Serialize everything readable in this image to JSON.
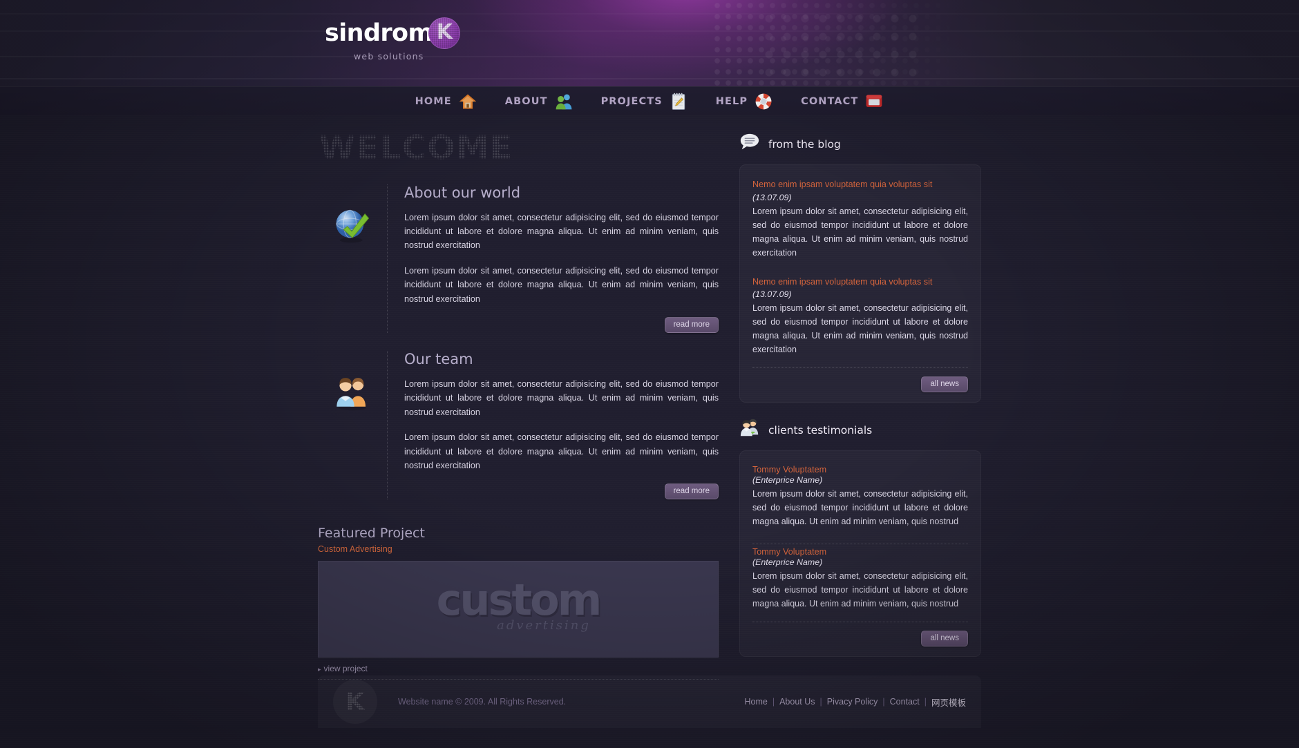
{
  "brand": {
    "word": "sindrom",
    "badge_letter": "K",
    "tagline": "web solutions"
  },
  "nav": {
    "items": [
      {
        "label": "HOME",
        "icon": "home-icon"
      },
      {
        "label": "ABOUT",
        "icon": "users-icon"
      },
      {
        "label": "PROJECTS",
        "icon": "notepad-icon"
      },
      {
        "label": "HELP",
        "icon": "lifering-icon"
      },
      {
        "label": "CONTACT",
        "icon": "phone-icon"
      }
    ]
  },
  "main": {
    "welcome": "WELCOME",
    "sections": [
      {
        "title": "About our world",
        "icon": "globe-check-icon",
        "paragraphs": [
          "Lorem ipsum dolor sit amet, consectetur adipisicing elit, sed do eiusmod tempor incididunt ut labore et dolore magna aliqua. Ut enim ad minim veniam, quis nostrud exercitation",
          "Lorem ipsum dolor sit amet, consectetur adipisicing elit, sed do eiusmod tempor incididunt ut labore et dolore magna aliqua. Ut enim ad minim veniam, quis nostrud exercitation"
        ],
        "button": "read more"
      },
      {
        "title": "Our team",
        "icon": "team-icon",
        "paragraphs": [
          "Lorem ipsum dolor sit amet, consectetur adipisicing elit, sed do eiusmod tempor incididunt ut labore et dolore magna aliqua. Ut enim ad minim veniam, quis nostrud exercitation",
          "Lorem ipsum dolor sit amet, consectetur adipisicing elit, sed do eiusmod tempor incididunt ut labore et dolore magna aliqua. Ut enim ad minim veniam, quis nostrud exercitation"
        ],
        "button": "read more"
      }
    ],
    "featured": {
      "title": "Featured Project",
      "subtitle": "Custom Advertising",
      "image_word": "custom",
      "image_sub": "advertising",
      "link": "view project"
    }
  },
  "blog": {
    "heading": "from the blog",
    "icon": "speech-bubble-icon",
    "posts": [
      {
        "title": "Nemo enim ipsam voluptatem quia voluptas sit",
        "date": "(13.07.09)",
        "text": "Lorem ipsum dolor sit amet, consectetur adipisicing elit, sed do eiusmod tempor incididunt ut labore et dolore magna aliqua. Ut enim ad minim veniam, quis nostrud exercitation"
      },
      {
        "title": "Nemo enim ipsam voluptatem quia voluptas sit",
        "date": "(13.07.09)",
        "text": "Lorem ipsum dolor sit amet, consectetur adipisicing elit, sed do eiusmod tempor incididunt ut labore et dolore magna aliqua. Ut enim ad minim veniam, quis nostrud exercitation"
      }
    ],
    "button": "all news"
  },
  "testimonials": {
    "heading": "clients testimonials",
    "icon": "clients-icon",
    "items": [
      {
        "name": "Tommy Voluptatem",
        "org": "(Enterprice Name)",
        "text": "Lorem ipsum dolor sit amet, consectetur adipisicing elit, sed do eiusmod tempor incididunt ut labore et dolore magna aliqua. Ut enim ad minim veniam, quis nostrud"
      },
      {
        "name": "Tommy Voluptatem",
        "org": "(Enterprice Name)",
        "text": "Lorem ipsum dolor sit amet, consectetur adipisicing elit, sed do eiusmod tempor incididunt ut labore et dolore magna aliqua. Ut enim ad minim veniam, quis nostrud"
      }
    ],
    "button": "all news"
  },
  "footer": {
    "badge_letter": "K",
    "copyright": "Website name © 2009. All Rights Reserved.",
    "links": [
      {
        "label": "Home"
      },
      {
        "label": "About Us"
      },
      {
        "label": "Pivacy Policy"
      },
      {
        "label": "Contact"
      },
      {
        "label": "网页模板"
      }
    ],
    "separator": "|"
  },
  "colors": {
    "accent_orange": "#d4643c",
    "brand_purple": "#8d3fae",
    "page_bg": "#201e2f",
    "title_text": "#b6aecb"
  }
}
